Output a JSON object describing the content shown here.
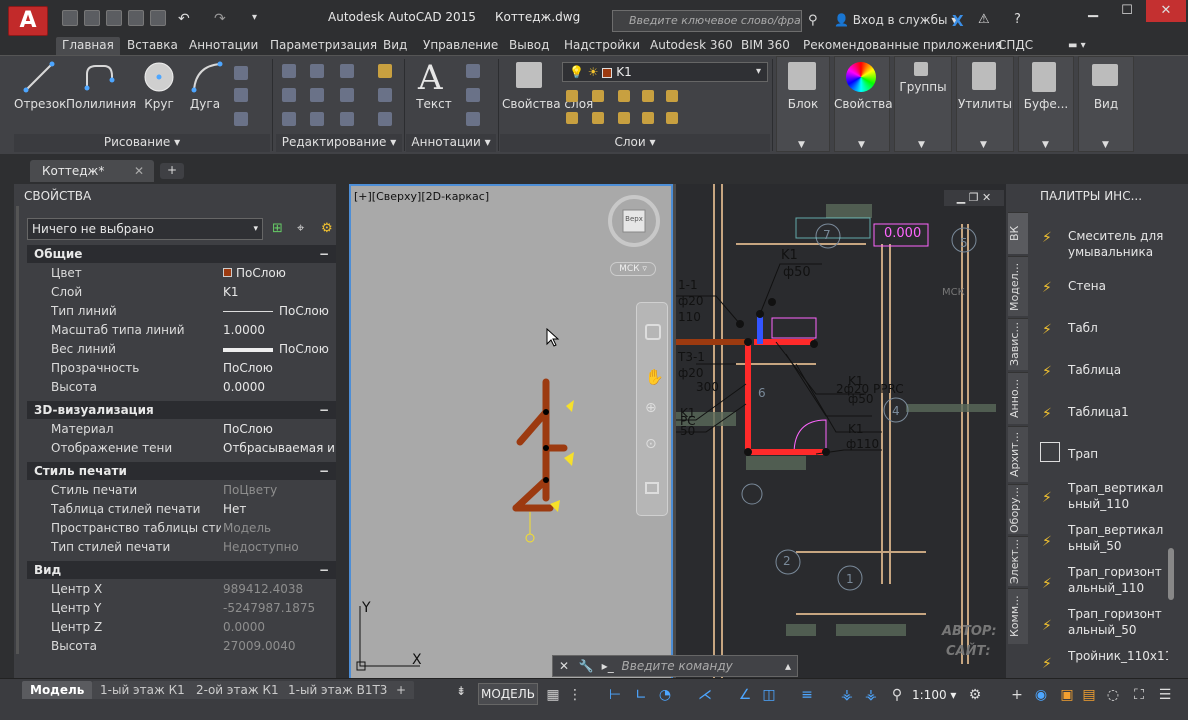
{
  "titlebar": {
    "app": "Autodesk AutoCAD 2015",
    "file": "Коттедж.dwg",
    "search_placeholder": "Введите ключевое слово/фразу",
    "login": "Вход в службы"
  },
  "ribbon_tabs": [
    "Главная",
    "Вставка",
    "Аннотации",
    "Параметризация",
    "Вид",
    "Управление",
    "Вывод",
    "Надстройки",
    "Autodesk 360",
    "BIM 360",
    "Рекомендованные приложения",
    "СПДС"
  ],
  "draw": {
    "line": "Отрезок",
    "polyline": "Полилиния",
    "circle": "Круг",
    "arc": "Дуга",
    "panel": "Рисование"
  },
  "modify_panel": "Редактирование",
  "annotate": {
    "text": "Текст",
    "panel": "Аннотации"
  },
  "layers": {
    "props": "Свойства слоя",
    "current": "K1",
    "panel": "Слои"
  },
  "big": {
    "block": "Блок",
    "properties": "Свойства",
    "groups": "Группы",
    "utilities": "Утилиты",
    "clipboard": "Буфе...",
    "view": "Вид"
  },
  "doc_tab": "Коттедж*",
  "properties": {
    "title": "СВОЙСТВА",
    "selection": "Ничего не выбрано",
    "sections": {
      "general": "Общие",
      "viz3d": "3D-визуализация",
      "plotstyle": "Стиль печати",
      "view": "Вид"
    },
    "general": [
      {
        "k": "Цвет",
        "v": "ПоСлою"
      },
      {
        "k": "Слой",
        "v": "K1"
      },
      {
        "k": "Тип линий",
        "v": "ПоСлою"
      },
      {
        "k": "Масштаб типа линий",
        "v": "1.0000"
      },
      {
        "k": "Вес линий",
        "v": "ПоСлою"
      },
      {
        "k": "Прозрачность",
        "v": "ПоСлою"
      },
      {
        "k": "Высота",
        "v": "0.0000"
      }
    ],
    "viz3d": [
      {
        "k": "Материал",
        "v": "ПоСлою"
      },
      {
        "k": "Отображение тени",
        "v": "Отбрасываемая и..."
      }
    ],
    "plotstyle": [
      {
        "k": "Стиль печати",
        "v": "ПоЦвету"
      },
      {
        "k": "Таблица стилей печати",
        "v": "Нет"
      },
      {
        "k": "Пространство таблицы сти...",
        "v": "Модель"
      },
      {
        "k": "Тип стилей печати",
        "v": "Недоступно"
      }
    ],
    "view": [
      {
        "k": "Центр X",
        "v": "989412.4038"
      },
      {
        "k": "Центр Y",
        "v": "-5247987.1875"
      },
      {
        "k": "Центр Z",
        "v": "0.0000"
      },
      {
        "k": "Высота",
        "v": "27009.0040"
      }
    ]
  },
  "viewport1": {
    "label": "[+][Сверху][2D-каркас]",
    "viewcube": "Верх",
    "ucs": "МСК",
    "axis_x": "X",
    "axis_y": "Y"
  },
  "viewport2": {
    "labels": [
      "K1",
      "ф50",
      "1-1",
      "ф20",
      "110",
      "T3-1",
      "ф20",
      "300",
      "K1",
      "PC",
      "50",
      "2ф20 PPRC",
      "K1",
      "ф50",
      "K1",
      "ф110",
      "0.000",
      "МСК",
      "АВТОР:",
      "САЙТ:"
    ],
    "circles": [
      "7",
      "6",
      "5",
      "4",
      "2",
      "1"
    ]
  },
  "tool_palettes": {
    "title": "ПАЛИТРЫ ИНС...",
    "items": [
      "Смеситель для умывальника",
      "Стена",
      "Табл",
      "Таблица",
      "Таблица1",
      "Трап",
      "Трап_вертикальный_110",
      "Трап_вертикальный_50",
      "Трап_горизонтальный_110",
      "Трап_горизонтальный_50",
      "Тройник_110х11"
    ],
    "tabs": [
      "ВК",
      "Модел...",
      "Завис...",
      "Анно...",
      "Архит...",
      "Обору...",
      "Элект...",
      "Комм..."
    ]
  },
  "command": {
    "placeholder": "Введите команду"
  },
  "layout_tabs": [
    "Модель",
    "1-ый этаж К1",
    "2-ой этаж К1",
    "1-ый этаж В1Т3"
  ],
  "status": {
    "model": "МОДЕЛЬ",
    "scale": "1:100"
  },
  "colors": {
    "accent": "#4d8ed6",
    "pipe_red": "#ff2a2a",
    "pipe_blue": "#3355ff",
    "pipe_brown": "#9c3a10"
  }
}
